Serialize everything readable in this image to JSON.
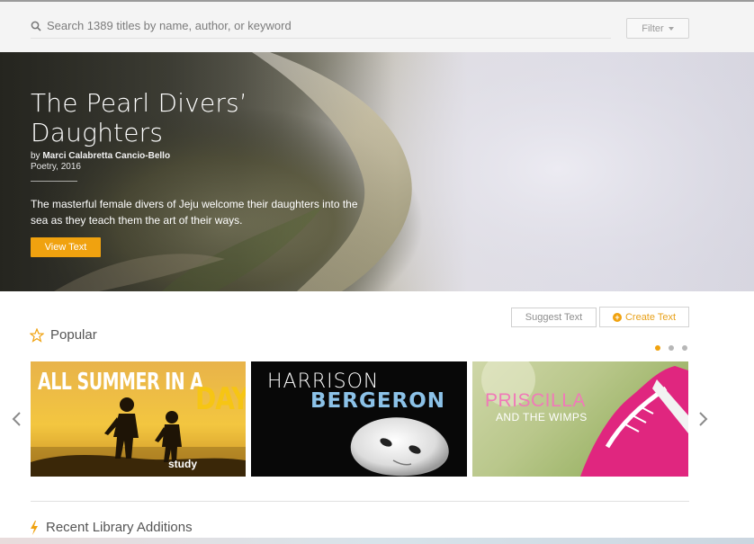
{
  "search": {
    "placeholder": "Search 1389 titles by name, author, or keyword",
    "filter_label": "Filter"
  },
  "hero": {
    "title_line1": "The Pearl Divers’",
    "title_line2": "Daughters",
    "by_prefix": "by",
    "author": "Marci Calabretta Cancio-Bello",
    "genre_year": "Poetry, 2016",
    "description": "The masterful female divers of Jeju welcome their daughters into the sea as they teach them the art of their ways.",
    "button_label": "View Text"
  },
  "popular": {
    "heading": "Popular",
    "suggest_label": "Suggest Text",
    "create_label": "Create Text",
    "cards": [
      {
        "title_a": "ALL SUMMER IN A",
        "title_b": "DAY",
        "badge": "study"
      },
      {
        "title_a": "HARRISON",
        "title_b": "BERGERON"
      },
      {
        "title_a": "PRISCILLA",
        "title_b": "AND THE WIMPS"
      }
    ],
    "dots": {
      "count": 3,
      "active": 0
    }
  },
  "recent": {
    "heading": "Recent Library Additions"
  },
  "colors": {
    "accent": "#f0a20f",
    "card2_subtitle": "#8cc2e8",
    "card3_title": "#f07ab8"
  },
  "icons": [
    "search-icon",
    "caret-down-icon",
    "star-icon",
    "plus-circle-icon",
    "chevron-left-icon",
    "chevron-right-icon",
    "bolt-icon"
  ]
}
